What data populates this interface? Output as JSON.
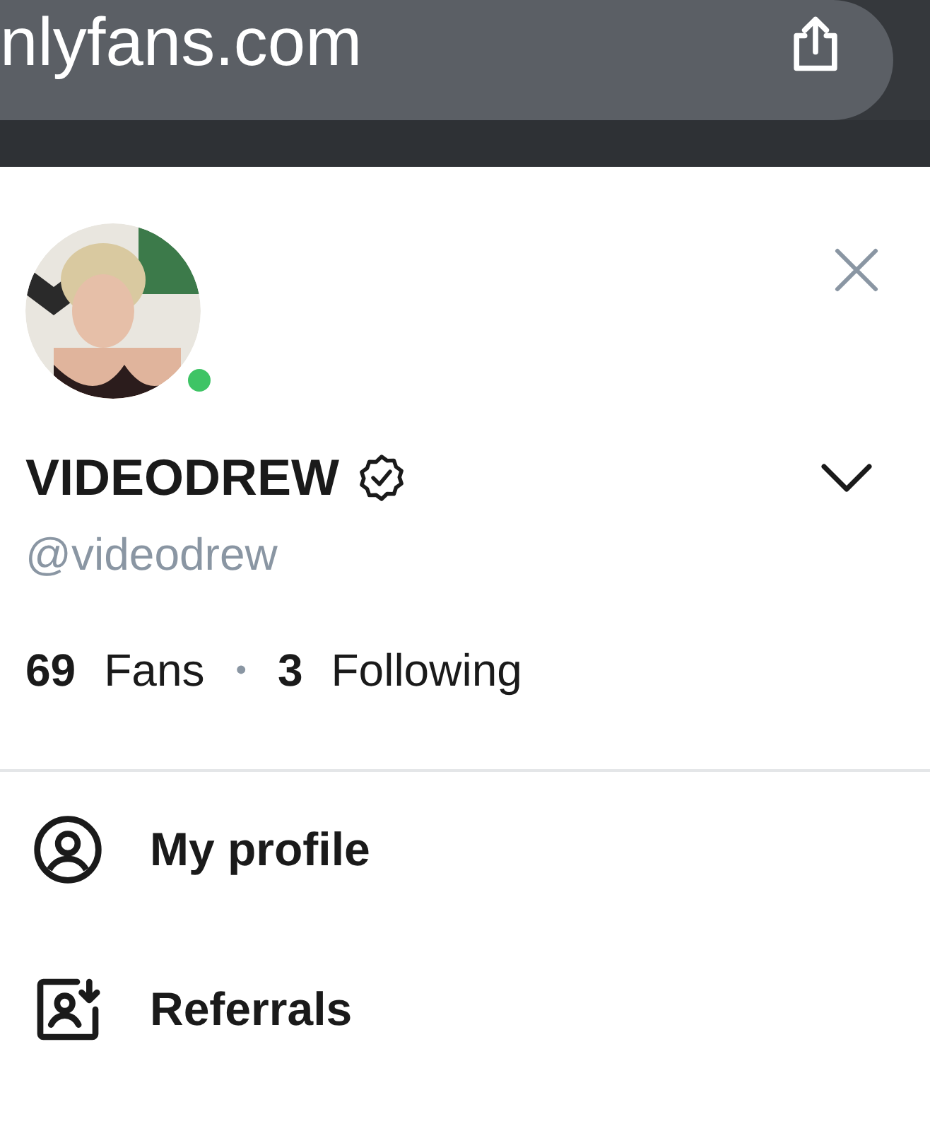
{
  "browser": {
    "url": "nlyfans.com"
  },
  "profile": {
    "name": "VIDEODREW",
    "verified": true,
    "handle": "@videodrew",
    "online": true,
    "stats": [
      {
        "count": "69",
        "label": "Fans"
      },
      {
        "count": "3",
        "label": "Following"
      }
    ],
    "separator": "•"
  },
  "menu": [
    {
      "kind": "profile",
      "label": "My profile"
    },
    {
      "kind": "referrals",
      "label": "Referrals"
    }
  ]
}
